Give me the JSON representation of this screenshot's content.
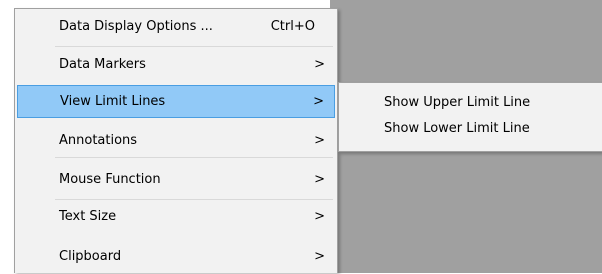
{
  "menu": {
    "items": [
      {
        "label": "Data Display Options ...",
        "shortcut": "Ctrl+O"
      },
      {
        "label": "Data Markers",
        "arrow": ">"
      },
      {
        "label": "View Limit Lines",
        "arrow": ">"
      },
      {
        "label": "Annotations",
        "arrow": ">"
      },
      {
        "label": "Mouse Function",
        "arrow": ">"
      },
      {
        "label": "Text Size",
        "arrow": ">"
      },
      {
        "label": "Clipboard",
        "arrow": ">"
      }
    ]
  },
  "submenu": {
    "items": [
      {
        "label": "Show Upper Limit Line"
      },
      {
        "label": "Show Lower Limit Line"
      }
    ]
  },
  "colors": {
    "highlight": "#91c9f7",
    "highlight_border": "#4a9ee2",
    "menu_background": "#f2f2f2",
    "canvas_background": "#a0a0a0"
  }
}
